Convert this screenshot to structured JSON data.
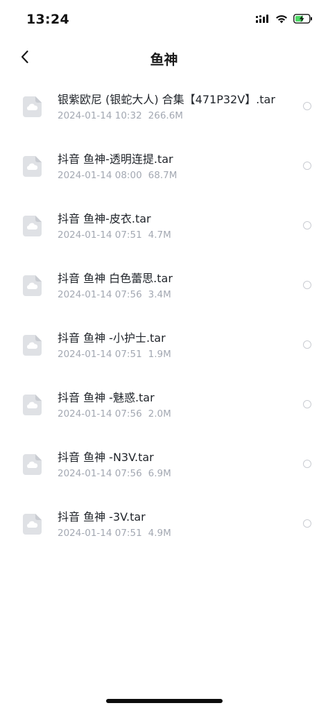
{
  "status_bar": {
    "time": "13:24",
    "icons": [
      "cellular-signal-icon",
      "wifi-icon",
      "battery-charging-icon"
    ],
    "battery_color": "#4cd964"
  },
  "nav": {
    "back_icon": "chevron-left-icon",
    "title": "鱼神"
  },
  "files": [
    {
      "name": "银紫欧尼 (银蛇大人) 合集【471P32V】.tar",
      "date": "2024-01-14 10:32",
      "size": "266.6M"
    },
    {
      "name": "抖音 鱼神-透明连提.tar",
      "date": "2024-01-14 08:00",
      "size": "68.7M"
    },
    {
      "name": "抖音 鱼神-皮衣.tar",
      "date": "2024-01-14 07:51",
      "size": "4.7M"
    },
    {
      "name": "抖音 鱼神 白色蕾思.tar",
      "date": "2024-01-14 07:56",
      "size": "3.4M"
    },
    {
      "name": "抖音 鱼神 -小护士.tar",
      "date": "2024-01-14 07:51",
      "size": "1.9M"
    },
    {
      "name": "抖音 鱼神 -魅惑.tar",
      "date": "2024-01-14 07:56",
      "size": "2.0M"
    },
    {
      "name": "抖音 鱼神 -N3V.tar",
      "date": "2024-01-14 07:56",
      "size": "6.9M"
    },
    {
      "name": "抖音 鱼神 -3V.tar",
      "date": "2024-01-14 07:51",
      "size": "4.9M"
    }
  ],
  "file_icon": "cloud-file-icon"
}
